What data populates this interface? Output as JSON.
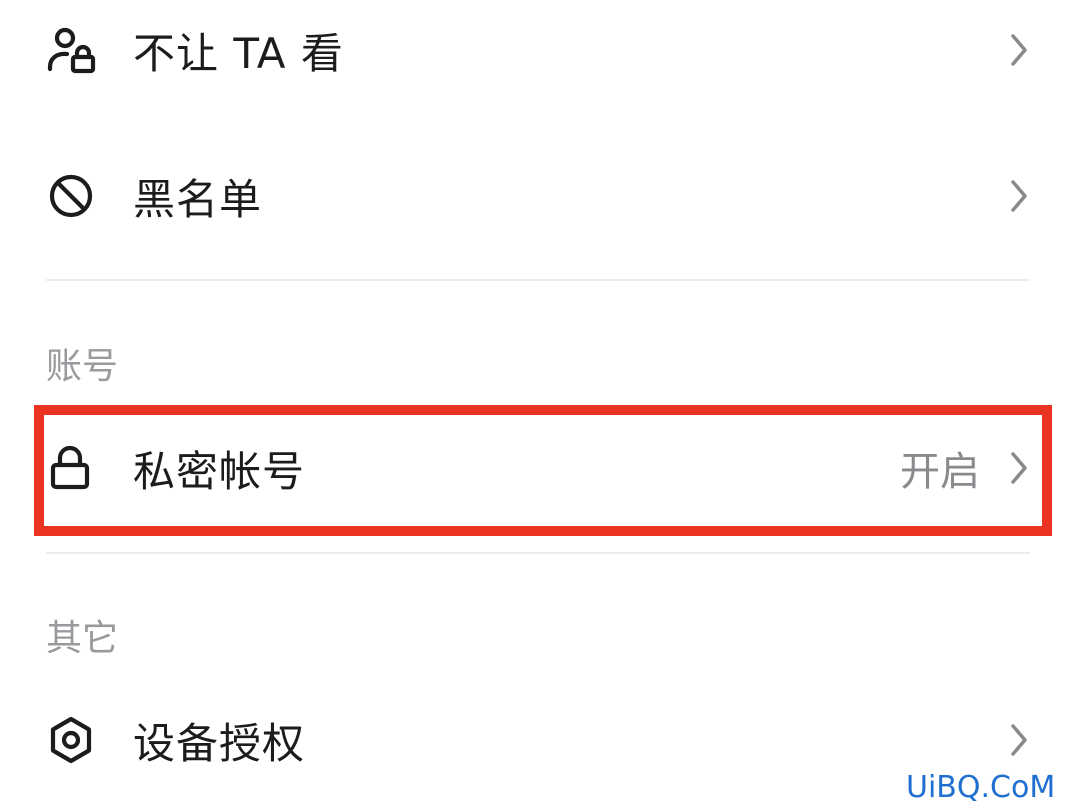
{
  "settings": {
    "rows": {
      "hide_from": {
        "label": "不让 TA 看",
        "icon": "user-lock-icon"
      },
      "blacklist": {
        "label": "黑名单",
        "icon": "block-icon"
      },
      "private_account": {
        "label": "私密帐号",
        "value": "开启",
        "icon": "lock-icon"
      },
      "device_auth": {
        "label": "设备授权",
        "icon": "hexagon-device-icon"
      }
    },
    "sections": {
      "account": "账号",
      "other": "其它"
    }
  },
  "highlight": {
    "color": "#ea3421"
  },
  "watermark": "UiBQ.CoM"
}
